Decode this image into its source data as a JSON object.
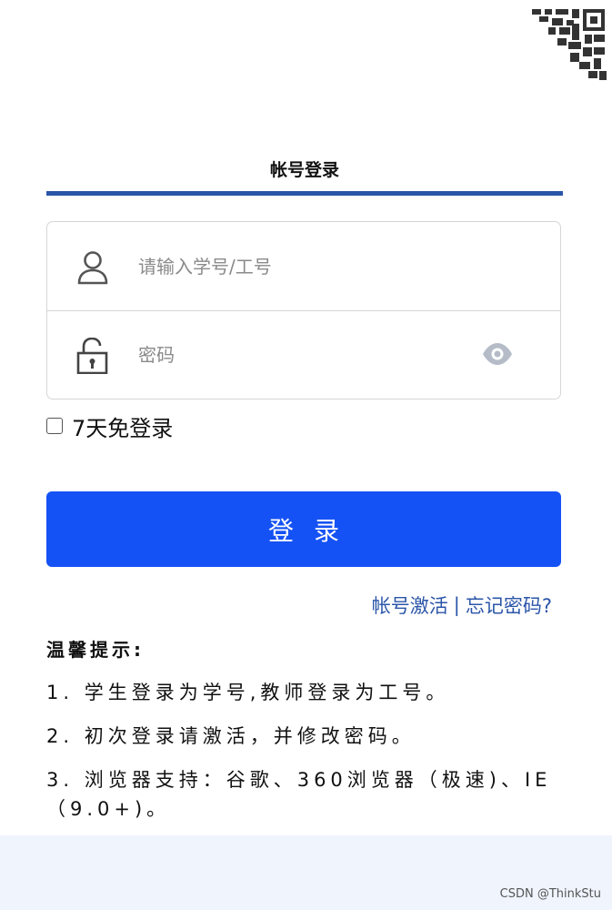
{
  "tab": {
    "title": "帐号登录"
  },
  "form": {
    "username_placeholder": "请输入学号/工号",
    "password_placeholder": "密码"
  },
  "remember": {
    "label": "7天免登录"
  },
  "login_button": {
    "label": "登录"
  },
  "links": {
    "activate": "帐号激活",
    "separator": "|",
    "forgot": "忘记密码?"
  },
  "tips": {
    "heading": "温馨提示:",
    "items": [
      "1. 学生登录为学号,教师登录为工号。",
      "2. 初次登录请激活，并修改密码。",
      "3. 浏览器支持：谷歌、360浏览器（极速)、IE（9.0+)。"
    ]
  },
  "watermark": "CSDN @ThinkStu",
  "colors": {
    "primary_button": "#1552f5",
    "tab_underline": "#2b55a8",
    "link": "#2b55a8",
    "footer_band": "#eff4fd"
  },
  "icons": [
    "qr-code-icon",
    "user-icon",
    "lock-icon",
    "eye-icon"
  ]
}
